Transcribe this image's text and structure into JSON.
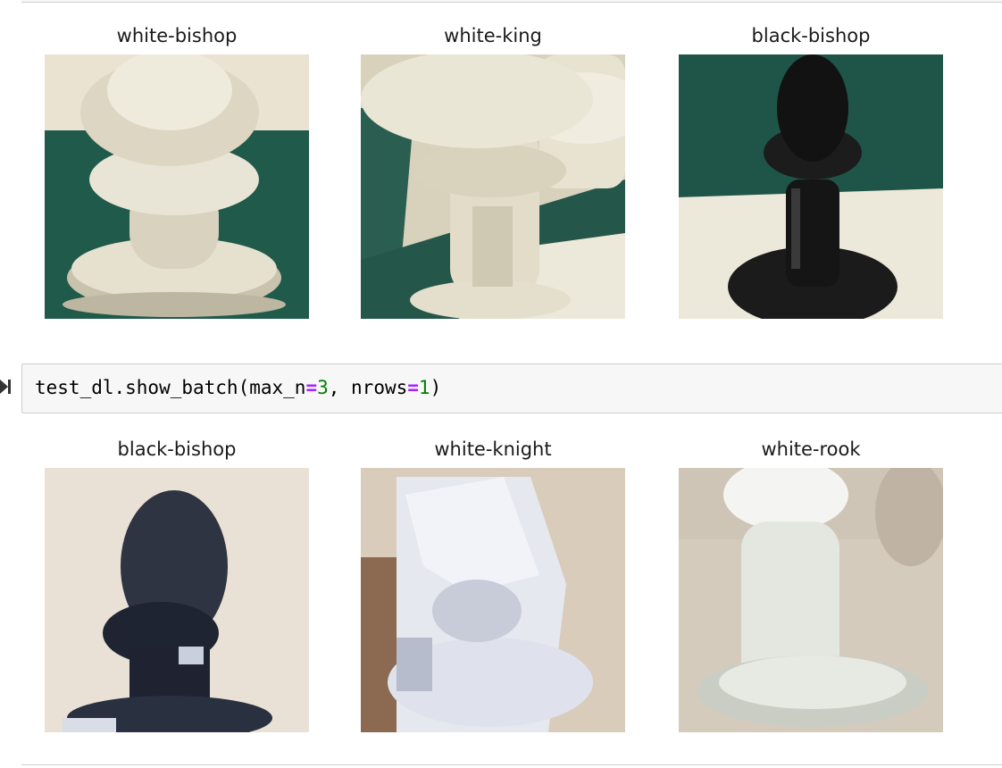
{
  "output_top": {
    "titles": [
      "white-bishop",
      "white-king",
      "black-bishop"
    ]
  },
  "code_cell": {
    "prefix": "test_dl.show_batch(max_n",
    "eq1": "=",
    "num1": "3",
    "mid": ", nrows",
    "eq2": "=",
    "num2": "1",
    "suffix": ")"
  },
  "output_bottom": {
    "titles": [
      "black-bishop",
      "white-knight",
      "white-rook"
    ]
  }
}
